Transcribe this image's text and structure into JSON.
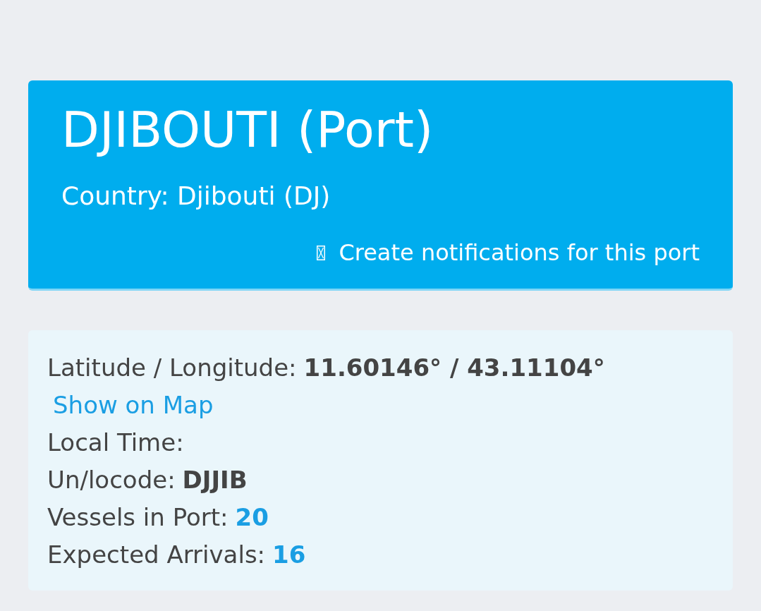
{
  "port_header": {
    "title": "DJIBOUTI (Port)",
    "country": "Country: Djibouti (DJ)",
    "notify_link": "Create notifications for this port"
  },
  "details": [
    {
      "label": "Latitude / Longitude:",
      "value": "11.60146° / 43.11104°",
      "kind": "text",
      "link": "Show on Map"
    },
    {
      "label": "Local Time:"
    },
    {
      "label": "Un/locode:",
      "value": "DJJIB",
      "kind": "text"
    },
    {
      "label": "Vessels in Port:",
      "value": "20",
      "kind": "link"
    },
    {
      "label": "Expected Arrivals:",
      "value": "16",
      "kind": "link"
    }
  ]
}
